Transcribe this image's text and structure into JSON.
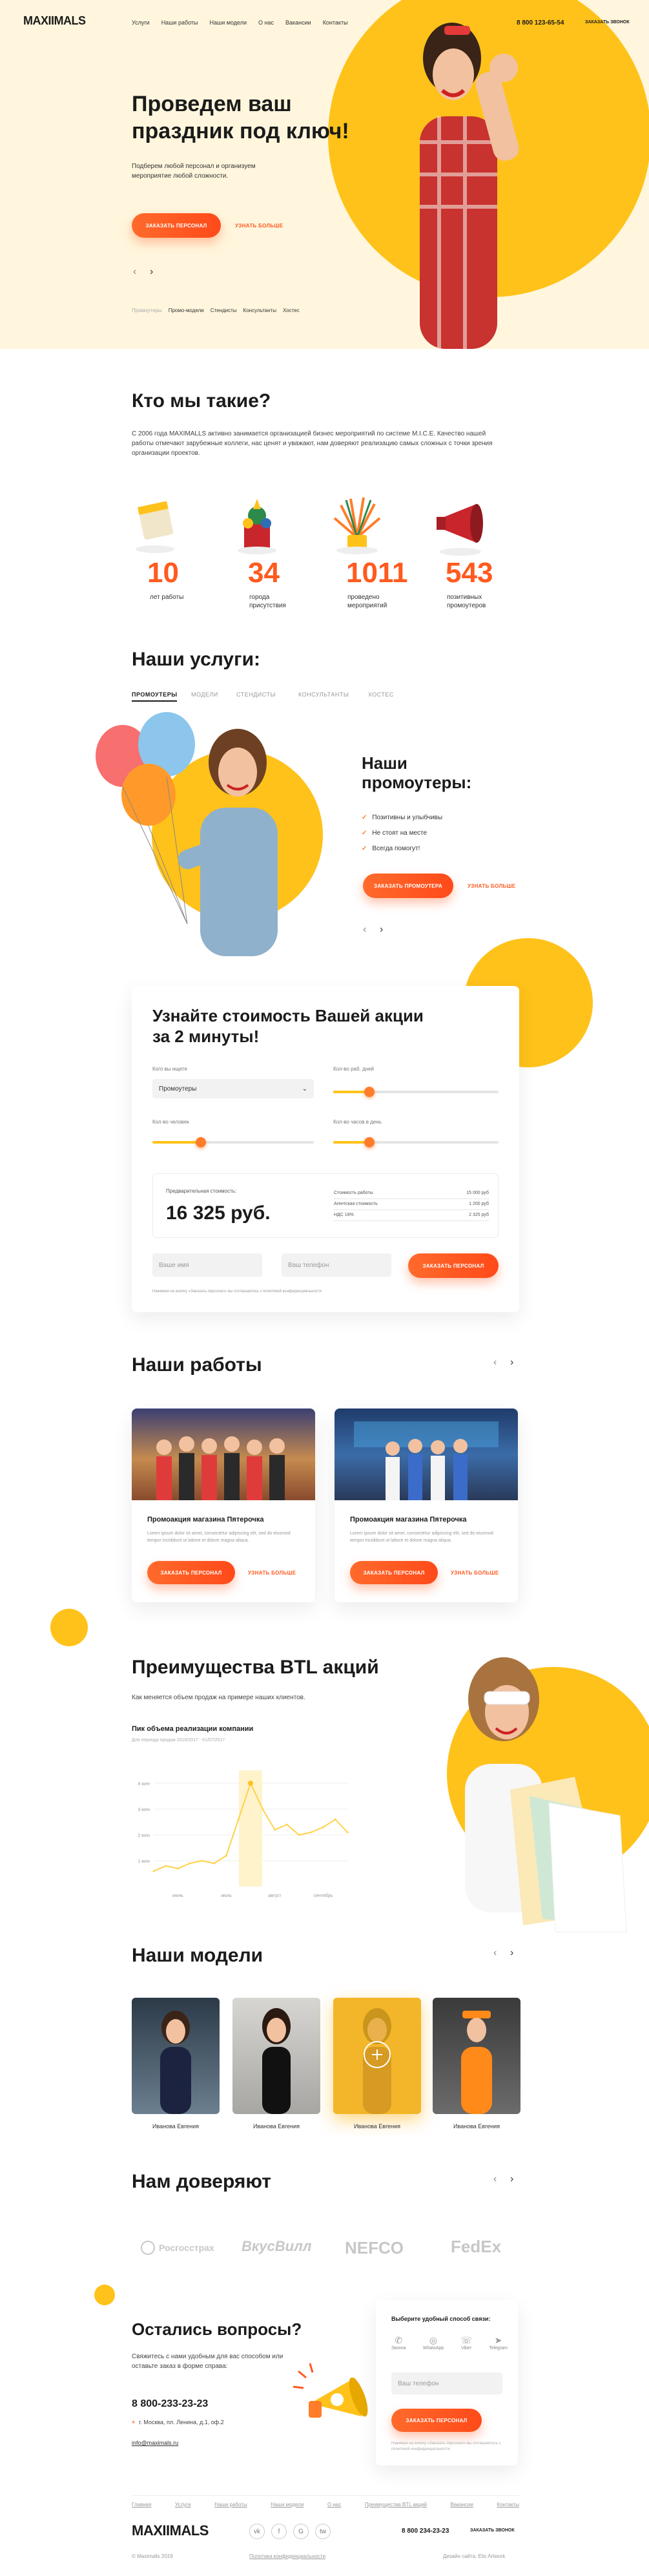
{
  "header": {
    "logo": "MAXIIMALS",
    "nav": [
      "Услуги",
      "Наши работы",
      "Наши модели",
      "О нас",
      "Вакансии",
      "Контакты"
    ],
    "phone": "8 800 123-65-54",
    "callback": "ЗАКАЗАТЬ ЗВОНОК"
  },
  "hero": {
    "title": "Проведем ваш праздник под ключ!",
    "text": "Подберем любой персонал и организуем мероприятие любой сложности.",
    "order_btn": "ЗАКАЗАТЬ ПЕРСОНАЛ",
    "more_link": "УЗНАТЬ БОЛЬШЕ",
    "prev": "‹",
    "next": "›",
    "chips": [
      "Промоутеры",
      "Промо-модели",
      "Стендисты",
      "Консультанты",
      "Хостес"
    ]
  },
  "about": {
    "title": "Кто мы такие?",
    "text": "С 2006 года MAXIMALLS активно занимается организацией бизнес мероприятий по системе M.I.C.E. Качество нашей работы отмечают зарубежные коллеги, нас ценят и уважают, нам доверяют реализацию самых сложных с точки зрения организации проектов.",
    "stats": [
      {
        "value": "10",
        "label": "лет работы"
      },
      {
        "value": "34",
        "label": "города присутствия"
      },
      {
        "value": "1011",
        "label": "проведено мероприятий"
      },
      {
        "value": "543",
        "label": "позитивных промоутеров"
      }
    ]
  },
  "services": {
    "title": "Наши услуги:",
    "tabs": [
      "ПРОМОУТЕРЫ",
      "МОДЕЛИ",
      "СТЕНДИСТЫ",
      "КОНСУЛЬТАНТЫ",
      "ХОСТЕС"
    ],
    "card_title": "Наши промоутеры:",
    "bullets": [
      "Позитивны и улыбчивы",
      "Не стоят на месте",
      "Всегда помогут!"
    ],
    "order_btn": "ЗАКАЗАТЬ ПРОМОУТЕРА",
    "more_link": "УЗНАТЬ БОЛЬШЕ",
    "prev": "‹",
    "next": "›"
  },
  "calc": {
    "title": "Узнайте стоимость Вашей акции за 2 минуты!",
    "who_label": "Кого вы ищете",
    "who_value": "Промоутеры",
    "days_label": "Кол-во раб. дней",
    "people_label": "Кол-во человек",
    "hours_label": "Кол-во часов в день",
    "days_fraction": 0.22,
    "people_fraction": 0.3,
    "hours_fraction": 0.22,
    "estimate_label": "Предварительная стоимость:",
    "estimate_value": "16 325 руб.",
    "lines": [
      {
        "name": "Стоимость работы",
        "value": "15 000 руб"
      },
      {
        "name": "Агентская стоимость",
        "value": "1 200 руб"
      },
      {
        "name": "НДС 18%",
        "value": "2 325 руб"
      }
    ],
    "name_placeholder": "Ваше имя",
    "phone_placeholder": "Ваш телефон",
    "submit": "ЗАКАЗАТЬ ПЕРСОНАЛ",
    "note": "Нажимая на кнопку «Заказать персонал» вы соглашаетесь с политикой конфиденциальности"
  },
  "works": {
    "title": "Наши работы",
    "prev": "‹",
    "next": "›",
    "items": [
      {
        "title": "Промоакция магазина Пятерочка",
        "text": "Lorem ipsum dolor sit amet, consectetur adipiscing elit, sed do eiusmod tempor incididunt ut labore et dolore magna aliqua.",
        "btn": "ЗАКАЗАТЬ ПЕРСОНАЛ",
        "link": "УЗНАТЬ БОЛЬШЕ"
      },
      {
        "title": "Промоакция магазина Пятерочка",
        "text": "Lorem ipsum dolor sit amet, consectetur adipiscing elit, sed do eiusmod tempor incididunt ut labore et dolore magna aliqua.",
        "btn": "ЗАКАЗАТЬ ПЕРСОНАЛ",
        "link": "УЗНАТЬ БОЛЬШЕ"
      }
    ]
  },
  "advantages": {
    "title": "Преимущества BTL акций",
    "text": "Как меняется объем продаж на примере наших клиентов.",
    "chart_title": "Пик объема реализации компании",
    "chart_subtitle": "Для периода продаж 2016/2017 - 01/07/2017"
  },
  "chart_data": {
    "type": "line",
    "x": [
      "июнь",
      "июль",
      "август",
      "сентябрь"
    ],
    "y_ticks": [
      "4 млн",
      "3 млн",
      "2 млн",
      "1 млн"
    ],
    "series": [
      {
        "values": [
          0.6,
          0.8,
          0.7,
          0.9,
          1.0,
          0.9,
          1.2,
          2.6,
          4.0,
          3.0,
          2.2,
          2.4,
          2.0,
          2.1,
          2.3,
          2.6,
          2.1
        ]
      }
    ],
    "ylim": [
      0,
      4.5
    ],
    "grid": true
  },
  "models": {
    "title": "Наши модели",
    "prev": "‹",
    "next": "›",
    "items": [
      {
        "name": "Иванова Евгения"
      },
      {
        "name": "Иванова Евгения"
      },
      {
        "name": "Иванова Евгения"
      },
      {
        "name": "Иванова Евгения"
      }
    ]
  },
  "trust": {
    "title": "Нам доверяют",
    "prev": "‹",
    "next": "›",
    "logos": [
      "Росгосстрах",
      "ВкусВилл",
      "NEFCO",
      "FedEx"
    ]
  },
  "contact": {
    "title": "Остались вопросы?",
    "text": "Свяжитесь с нами удобным для вас способом или оставьте заказ в форме справа:",
    "phone": "8 800-233-23-23",
    "address": "г. Москва, пл. Ленина, д.1, оф.2",
    "email": "info@maximals.ru",
    "form_title": "Выберите удобный способ связи:",
    "methods": [
      "Звонок",
      "WhatsApp",
      "Viber",
      "Telegram"
    ],
    "phone_placeholder": "Ваш телефон",
    "submit": "ЗАКАЗАТЬ ПЕРСОНАЛ",
    "note": "Нажимая на кнопку «Заказать персонал» вы соглашаетесь с политикой конфиденциальности"
  },
  "footer": {
    "links": [
      "Главная",
      "Услуги",
      "Наши работы",
      "Наши модели",
      "О нас",
      "Преимущества BTL акций",
      "Вакансии",
      "Контакты"
    ],
    "logo": "MAXIIMALS",
    "social": [
      "vk",
      "f",
      "G",
      "tw"
    ],
    "phone": "8 800 234-23-23",
    "callback": "ЗАКАЗАТЬ ЗВОНОК",
    "copyright": "© Maximalls 2019",
    "privacy": "Политика конфиденциальности",
    "credit": "Дизайн сайта: Elis Artwork"
  },
  "colors": {
    "accent": "#ff5a1f",
    "yellow": "#ffc21a",
    "cream": "#fff6dd"
  }
}
